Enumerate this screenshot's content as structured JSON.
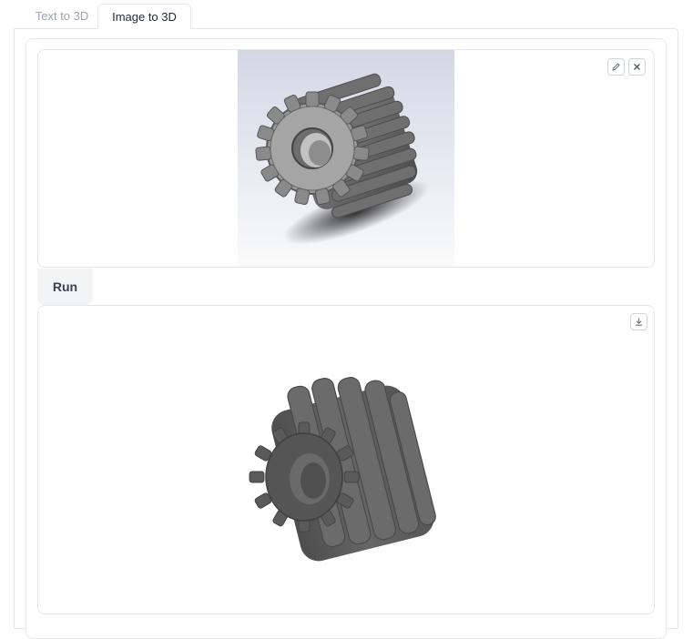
{
  "tabs": [
    {
      "label": "Text to 3D",
      "active": false
    },
    {
      "label": "Image to 3D",
      "active": true
    }
  ],
  "image_input": {
    "icons": [
      "pencil-icon",
      "close-icon"
    ],
    "preview": "gear-image"
  },
  "run_button": {
    "label": "Run"
  },
  "model_output": {
    "icons": [
      "download-icon"
    ],
    "preview": "gear-3d-model"
  },
  "colors": {
    "border": "#e5e7eb",
    "button_bg": "#f3f4f6",
    "text": "#374151",
    "inactive_tab": "#9ca3af",
    "model_gray": "#5b5b5b"
  }
}
